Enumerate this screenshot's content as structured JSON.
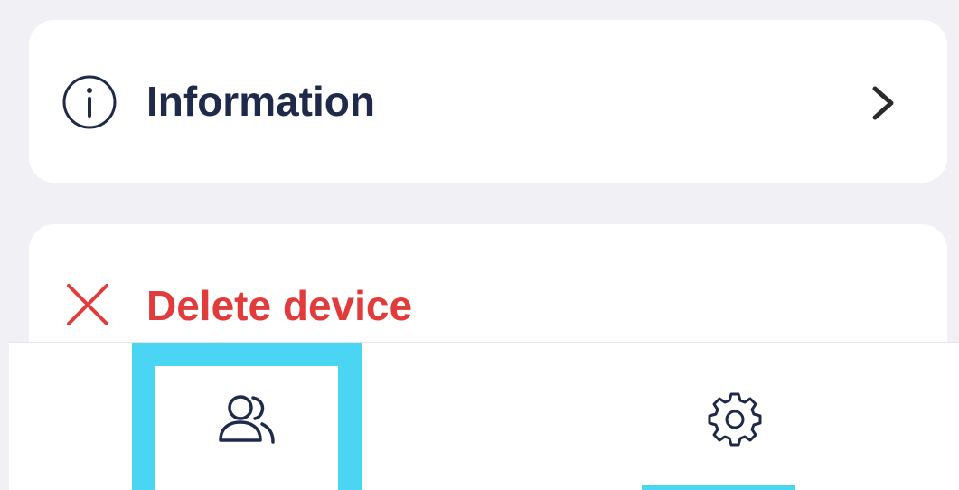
{
  "menu": {
    "information_label": "Information",
    "delete_label": "Delete device"
  },
  "tabbar": {
    "tabs": [
      {
        "icon": "users-icon",
        "selected_highlight": true
      },
      {
        "icon": "gear-icon",
        "active": true
      }
    ]
  },
  "colors": {
    "text_primary": "#1f2a4a",
    "danger": "#e23b3b",
    "highlight": "#4ad5f3",
    "background": "#f1f1f5",
    "card": "#ffffff"
  }
}
